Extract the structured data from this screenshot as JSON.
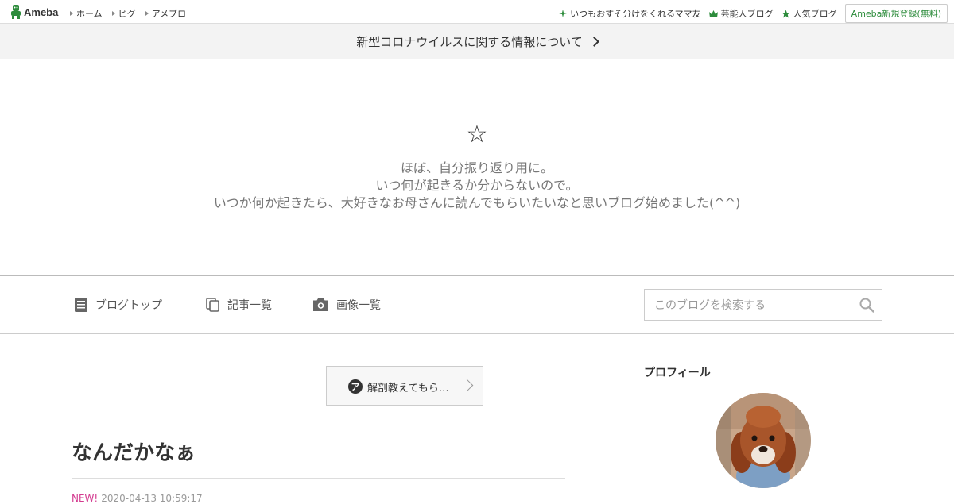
{
  "topbar": {
    "logo_text": "Ameba",
    "nav_left": [
      "ホーム",
      "ピグ",
      "アメブロ"
    ],
    "nav_right": [
      {
        "icon": "sparkle-icon",
        "label": "いつもおすそ分けをくれるママ友"
      },
      {
        "icon": "crown-icon",
        "label": "芸能人ブログ"
      },
      {
        "icon": "star-icon",
        "label": "人気ブログ"
      }
    ],
    "signup_label": "Ameba新規登録(無料)"
  },
  "notice": {
    "label": "新型コロナウイルスに関する情報について"
  },
  "blog_header": {
    "title_symbol": "☆",
    "description_lines": [
      "ほぼ、自分振り返り用に。",
      "いつ何が起きるか分からないので。",
      "いつか何か起きたら、大好きなお母さんに読んでもらいたいなと思いブログ始めました(^^)"
    ]
  },
  "blog_nav": {
    "items": [
      {
        "icon": "document-icon",
        "label": "ブログトップ"
      },
      {
        "icon": "copy-icon",
        "label": "記事一覧"
      },
      {
        "icon": "camera-icon",
        "label": "画像一覧"
      }
    ],
    "search_placeholder": "このブログを検索する"
  },
  "main": {
    "theme_button": {
      "icon_char": "ア",
      "label": "解剖教えてもら…"
    },
    "entry": {
      "title": "なんだかなぁ",
      "badge": "NEW!",
      "date": "2020-04-13 10:59:17"
    }
  },
  "side": {
    "profile_heading": "プロフィール"
  },
  "colors": {
    "ameba_green": "#2d8c3c",
    "new_badge": "#d33a8f",
    "notice_bg": "#f3f3f3"
  }
}
